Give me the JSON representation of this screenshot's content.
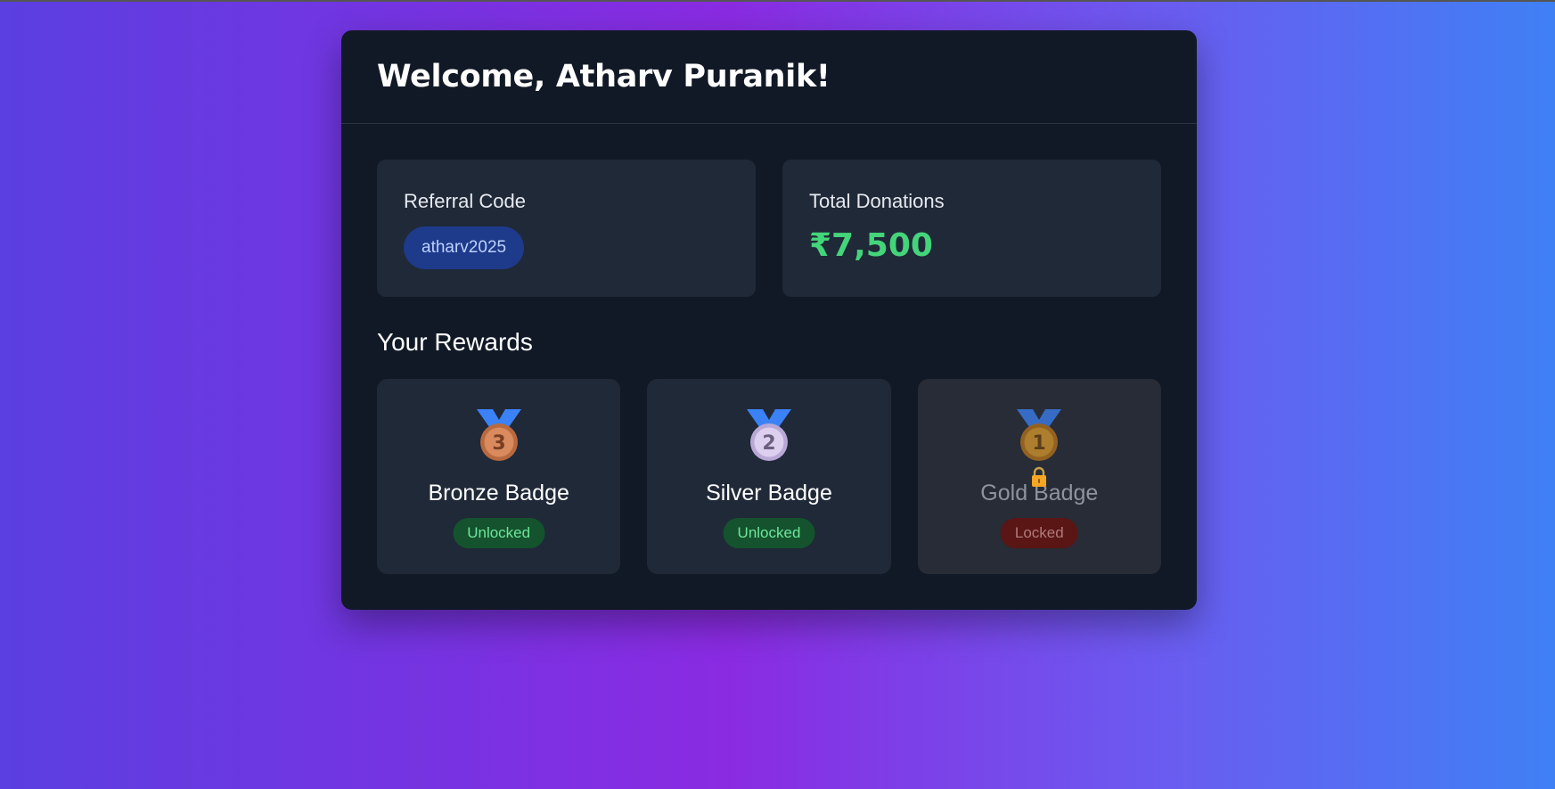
{
  "header": {
    "title": "Welcome, Atharv Puranik!"
  },
  "stats": {
    "referral": {
      "label": "Referral Code",
      "code": "atharv2025"
    },
    "donations": {
      "label": "Total Donations",
      "value": "₹7,500"
    }
  },
  "rewards": {
    "title": "Your Rewards",
    "items": [
      {
        "name": "Bronze Badge",
        "status": "Unlocked",
        "medal_number": "3",
        "icon": "bronze-medal-icon"
      },
      {
        "name": "Silver Badge",
        "status": "Unlocked",
        "medal_number": "2",
        "icon": "silver-medal-icon"
      },
      {
        "name": "Gold Badge",
        "status": "Locked",
        "medal_number": "1",
        "icon": "gold-medal-icon"
      }
    ]
  },
  "colors": {
    "card_bg": "#121926",
    "panel_bg": "#202938",
    "accent_green": "#44d57a",
    "code_pill_bg": "#1e3a8a",
    "unlocked_bg": "#14532d",
    "locked_bg": "#5a1515"
  }
}
